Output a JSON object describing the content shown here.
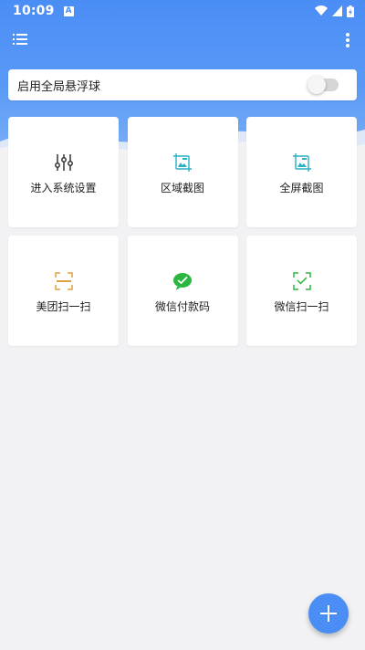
{
  "status_bar": {
    "time": "10:09",
    "notification_icon_glyph": "A",
    "icons": [
      "wifi-icon",
      "signal-icon",
      "battery-icon"
    ]
  },
  "toolbar": {
    "left_icon": "list-menu-icon",
    "right_icon": "more-vert-icon"
  },
  "floating_ball": {
    "label": "启用全局悬浮球",
    "enabled": false
  },
  "tiles": [
    {
      "label": "进入系统设置",
      "icon": "sliders-icon",
      "icon_color": "#333333"
    },
    {
      "label": "区域截图",
      "icon": "region-screenshot-icon",
      "icon_color": "#2ab0c4"
    },
    {
      "label": "全屏截图",
      "icon": "fullscreen-screenshot-icon",
      "icon_color": "#2ab0c4"
    },
    {
      "label": "美团扫一扫",
      "icon": "meituan-scan-icon",
      "icon_color": "#e0a040"
    },
    {
      "label": "微信付款码",
      "icon": "wechat-pay-icon",
      "icon_color": "#2bb640"
    },
    {
      "label": "微信扫一扫",
      "icon": "wechat-scan-icon",
      "icon_color": "#2bb640"
    }
  ],
  "fab": {
    "icon": "plus-icon",
    "color": "#4a8df5"
  },
  "colors": {
    "header": "#4a8df5",
    "background": "#f2f2f4"
  }
}
